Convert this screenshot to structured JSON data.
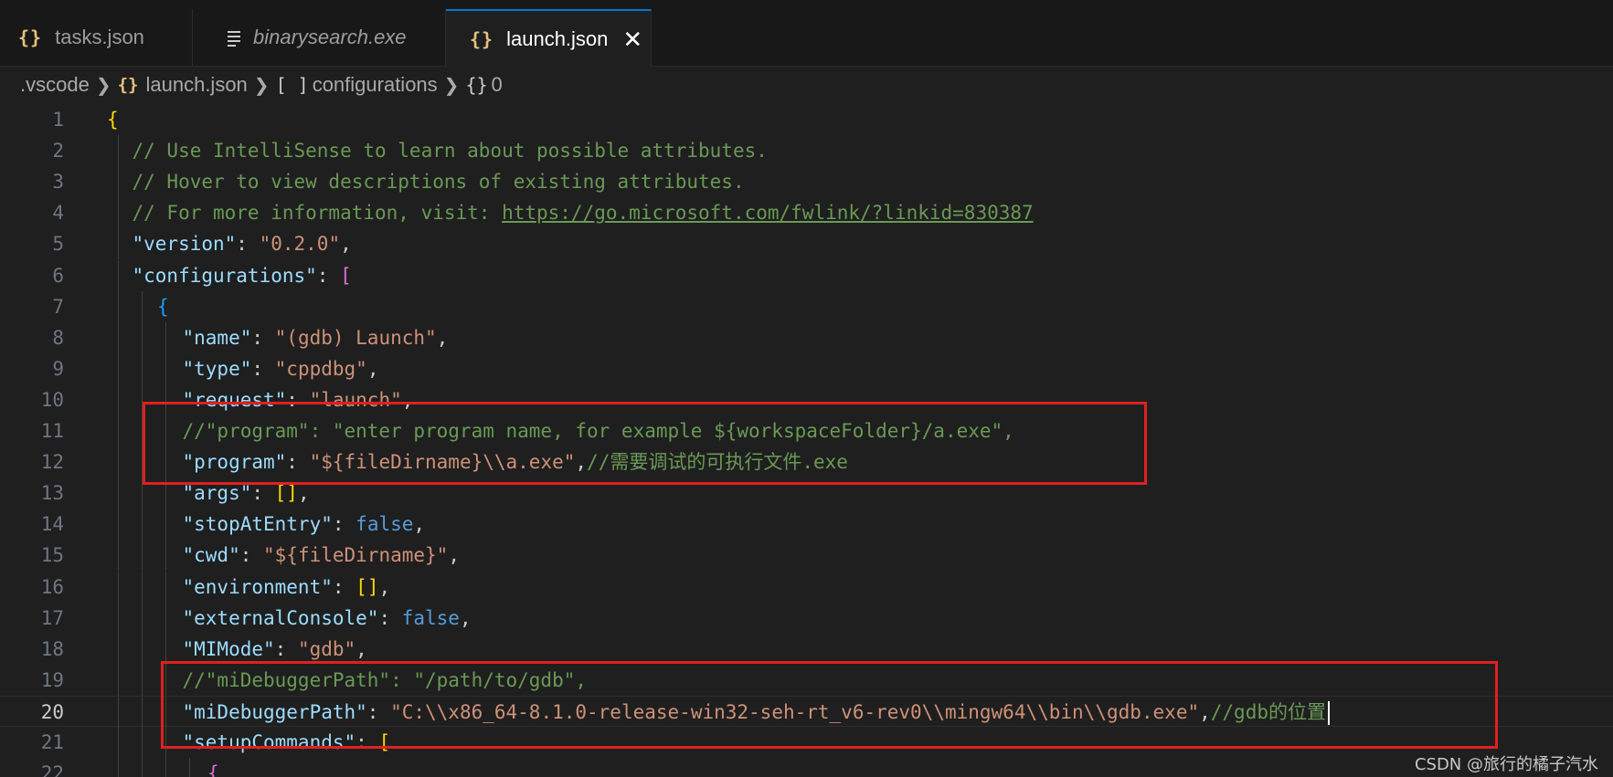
{
  "tabs": [
    {
      "icon": "{}",
      "label": "tasks.json"
    },
    {
      "icon": "lines",
      "label": "binarysearch.exe"
    },
    {
      "icon": "{}",
      "label": "launch.json",
      "active": true
    }
  ],
  "breadcrumb": {
    "folder": ".vscode",
    "file": "launch.json",
    "array_symbol": "[ ]",
    "array": "configurations",
    "object_symbol": "{}",
    "object": "0"
  },
  "editor": {
    "current_line": 20,
    "lines": [
      {
        "n": "1",
        "parts": [
          {
            "t": "{",
            "c": "b1"
          }
        ]
      },
      {
        "n": "2",
        "parts": [
          {
            "t": "// Use IntelliSense to learn about possible attributes.",
            "c": "c-com"
          }
        ]
      },
      {
        "n": "3",
        "parts": [
          {
            "t": "// Hover to view descriptions of existing attributes.",
            "c": "c-com"
          }
        ]
      },
      {
        "n": "4",
        "parts": [
          {
            "t": "// For more information, visit: ",
            "c": "c-com"
          },
          {
            "t": "https://go.microsoft.com/fwlink/?linkid=830387",
            "c": "c-link"
          }
        ]
      },
      {
        "n": "5",
        "parts": [
          {
            "t": "\"version\"",
            "c": "c-key"
          },
          {
            "t": ": ",
            "c": "c-punc"
          },
          {
            "t": "\"0.2.0\"",
            "c": "c-str"
          },
          {
            "t": ",",
            "c": "c-punc"
          }
        ]
      },
      {
        "n": "6",
        "parts": [
          {
            "t": "\"configurations\"",
            "c": "c-key"
          },
          {
            "t": ": ",
            "c": "c-punc"
          },
          {
            "t": "[",
            "c": "b2"
          }
        ]
      },
      {
        "n": "7",
        "parts": [
          {
            "t": "{",
            "c": "b3"
          }
        ]
      },
      {
        "n": "8",
        "parts": [
          {
            "t": "\"name\"",
            "c": "c-key"
          },
          {
            "t": ": ",
            "c": "c-punc"
          },
          {
            "t": "\"(gdb) Launch\"",
            "c": "c-str"
          },
          {
            "t": ",",
            "c": "c-punc"
          }
        ]
      },
      {
        "n": "9",
        "parts": [
          {
            "t": "\"type\"",
            "c": "c-key"
          },
          {
            "t": ": ",
            "c": "c-punc"
          },
          {
            "t": "\"cppdbg\"",
            "c": "c-str"
          },
          {
            "t": ",",
            "c": "c-punc"
          }
        ]
      },
      {
        "n": "10",
        "parts": [
          {
            "t": "\"request\"",
            "c": "c-key"
          },
          {
            "t": ": ",
            "c": "c-punc"
          },
          {
            "t": "\"launch\"",
            "c": "c-str"
          },
          {
            "t": ",",
            "c": "c-punc"
          }
        ]
      },
      {
        "n": "11",
        "parts": [
          {
            "t": "//\"program\": \"enter program name, for example ${workspaceFolder}/a.exe\",",
            "c": "c-com"
          }
        ]
      },
      {
        "n": "12",
        "parts": [
          {
            "t": "\"program\"",
            "c": "c-key"
          },
          {
            "t": ": ",
            "c": "c-punc"
          },
          {
            "t": "\"${fileDirname}\\\\a.exe\"",
            "c": "c-str"
          },
          {
            "t": ",",
            "c": "c-punc"
          },
          {
            "t": "//需要调试的可执行文件.exe",
            "c": "c-com"
          }
        ]
      },
      {
        "n": "13",
        "parts": [
          {
            "t": "\"args\"",
            "c": "c-key"
          },
          {
            "t": ": ",
            "c": "c-punc"
          },
          {
            "t": "[]",
            "c": "b1"
          },
          {
            "t": ",",
            "c": "c-punc"
          }
        ]
      },
      {
        "n": "14",
        "parts": [
          {
            "t": "\"stopAtEntry\"",
            "c": "c-key"
          },
          {
            "t": ": ",
            "c": "c-punc"
          },
          {
            "t": "false",
            "c": "c-bool"
          },
          {
            "t": ",",
            "c": "c-punc"
          }
        ]
      },
      {
        "n": "15",
        "parts": [
          {
            "t": "\"cwd\"",
            "c": "c-key"
          },
          {
            "t": ": ",
            "c": "c-punc"
          },
          {
            "t": "\"${fileDirname}\"",
            "c": "c-str"
          },
          {
            "t": ",",
            "c": "c-punc"
          }
        ]
      },
      {
        "n": "16",
        "parts": [
          {
            "t": "\"environment\"",
            "c": "c-key"
          },
          {
            "t": ": ",
            "c": "c-punc"
          },
          {
            "t": "[]",
            "c": "b1"
          },
          {
            "t": ",",
            "c": "c-punc"
          }
        ]
      },
      {
        "n": "17",
        "parts": [
          {
            "t": "\"externalConsole\"",
            "c": "c-key"
          },
          {
            "t": ": ",
            "c": "c-punc"
          },
          {
            "t": "false",
            "c": "c-bool"
          },
          {
            "t": ",",
            "c": "c-punc"
          }
        ]
      },
      {
        "n": "18",
        "parts": [
          {
            "t": "\"MIMode\"",
            "c": "c-key"
          },
          {
            "t": ": ",
            "c": "c-punc"
          },
          {
            "t": "\"gdb\"",
            "c": "c-str"
          },
          {
            "t": ",",
            "c": "c-punc"
          }
        ]
      },
      {
        "n": "19",
        "parts": [
          {
            "t": "//\"miDebuggerPath\": \"/path/to/gdb\",",
            "c": "c-com"
          }
        ]
      },
      {
        "n": "20",
        "parts": [
          {
            "t": "\"miDebuggerPath\"",
            "c": "c-key"
          },
          {
            "t": ": ",
            "c": "c-punc"
          },
          {
            "t": "\"C:\\\\x86_64-8.1.0-release-win32-seh-rt_v6-rev0\\\\mingw64\\\\bin\\\\gdb.exe\"",
            "c": "c-str"
          },
          {
            "t": ",",
            "c": "c-punc"
          },
          {
            "t": "//gdb的位置",
            "c": "c-com"
          }
        ]
      },
      {
        "n": "21",
        "parts": [
          {
            "t": "\"setupCommands\"",
            "c": "c-key"
          },
          {
            "t": ": ",
            "c": "c-punc"
          },
          {
            "t": "[",
            "c": "b1"
          }
        ]
      },
      {
        "n": "22",
        "parts": [
          {
            "t": "{",
            "c": "b2"
          }
        ]
      }
    ]
  },
  "watermark": "CSDN @旅行的橘子汽水"
}
